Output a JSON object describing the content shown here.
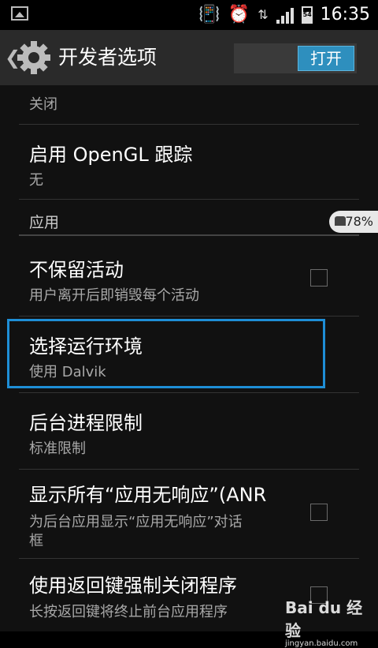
{
  "status_bar": {
    "time": "16:35",
    "battery_level": "54"
  },
  "action_bar": {
    "title": "开发者选项",
    "switch_label": "打开"
  },
  "list": {
    "top_summary": "关闭",
    "opengl": {
      "title": "启用 OpenGL 跟踪",
      "summary": "无"
    },
    "section_apps": "应用",
    "dont_keep": {
      "title": "不保留活动",
      "summary": "用户离开后即销毁每个活动",
      "checked": false
    },
    "runtime": {
      "title": "选择运行环境",
      "summary": "使用 Dalvik"
    },
    "bg_limit": {
      "title": "后台进程限制",
      "summary": "标准限制"
    },
    "show_anr": {
      "title": "显示所有“应用无响应”(ANR",
      "summary_line1": "为后台应用显示“应用无响应”对话",
      "summary_line2": "框",
      "checked": false
    },
    "back_kill": {
      "title": "使用返回键强制关闭程序",
      "summary": "长按返回键将终止前台应用程序"
    }
  },
  "overlay": {
    "battery_badge": "78%",
    "watermark": "Bai du 经验",
    "watermark_url": "jingyan.baidu.com"
  },
  "colors": {
    "accent": "#2e8fbe",
    "highlight": "#1e8ed6"
  }
}
